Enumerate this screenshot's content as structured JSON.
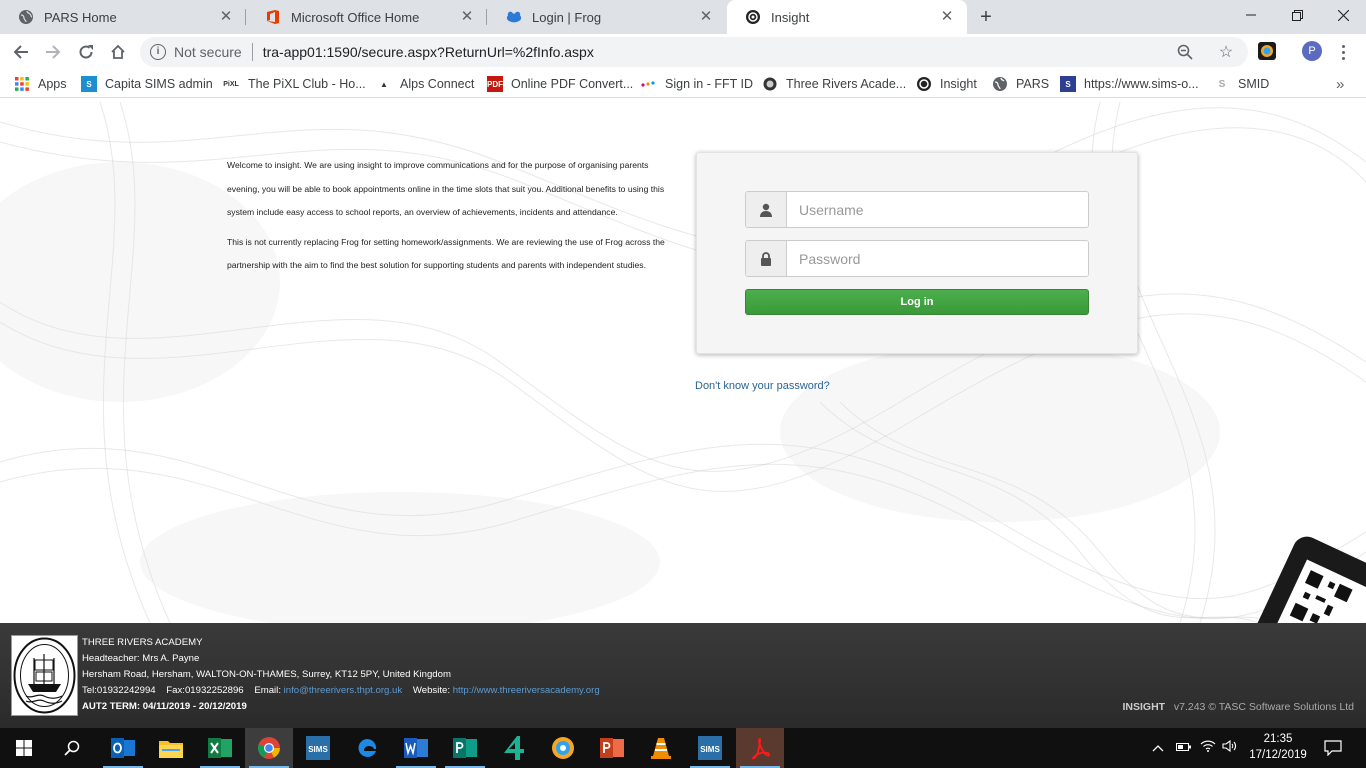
{
  "browser": {
    "tabs": [
      {
        "title": "PARS Home",
        "active": false
      },
      {
        "title": "Microsoft Office Home",
        "active": false
      },
      {
        "title": "Login | Frog",
        "active": false
      },
      {
        "title": "Insight",
        "active": true
      }
    ],
    "address": {
      "security_label": "Not secure",
      "url": "tra-app01:1590/secure.aspx?ReturnUrl=%2fInfo.aspx"
    },
    "profile_initial": "P",
    "bookmarks": [
      {
        "label": "Apps"
      },
      {
        "label": "Capita SIMS admin"
      },
      {
        "label": "The PiXL Club - Ho..."
      },
      {
        "label": "Alps Connect"
      },
      {
        "label": "Online PDF Convert..."
      },
      {
        "label": "Sign in - FFT ID"
      },
      {
        "label": "Three Rivers Acade..."
      },
      {
        "label": "Insight"
      },
      {
        "label": "PARS"
      },
      {
        "label": "https://www.sims-o..."
      },
      {
        "label": "SMID"
      }
    ]
  },
  "intro": {
    "p1": "Welcome to insight. We are using insight to improve communications and for the purpose of organising parents evening, you will be able to book appointments online in the time slots that suit you. Additional benefits to using this system include easy access to school reports, an overview of achievements, incidents and attendance.",
    "p2": "This is not currently replacing Frog for setting homework/assignments. We are reviewing the use of Frog across the partnership with the aim to find the best solution for supporting students and parents with independent studies."
  },
  "login": {
    "username_placeholder": "Username",
    "password_placeholder": "Password",
    "button_label": "Log in",
    "forgot_link": "Don't know your password?"
  },
  "footer": {
    "school_name": "THREE RIVERS ACADEMY",
    "headteacher": "Headteacher: Mrs A. Payne",
    "address": "Hersham Road, Hersham, WALTON-ON-THAMES, Surrey, KT12 5PY, United Kingdom",
    "tel": "Tel:01932242994",
    "fax": "Fax:01932252896",
    "email_label": "Email:",
    "email": "info@threerivers.thpt.org.uk",
    "website_label": "Website:",
    "website": "http://www.threeriversacademy.org",
    "term": "AUT2 TERM: 04/11/2019 - 20/12/2019",
    "product": "INSIGHT",
    "version": "v7.243",
    "copyright": "© TASC Software Solutions Ltd"
  },
  "taskbar": {
    "time": "21:35",
    "date": "17/12/2019"
  },
  "colors": {
    "login_button": "#449d44",
    "link": "#2a6496",
    "footer_bg": "#333333",
    "taskbar_bg": "#101010"
  }
}
